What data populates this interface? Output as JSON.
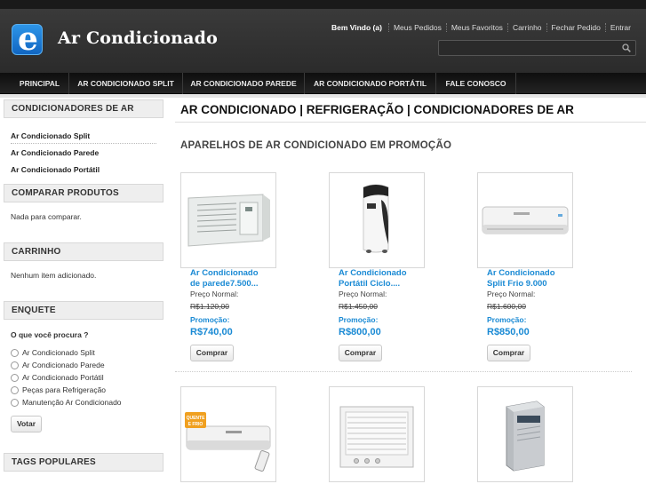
{
  "header": {
    "logo_letter": "e",
    "site_title": "Ar Condicionado",
    "welcome": "Bem Vindo (a)",
    "links": [
      "Meus Pedidos",
      "Meus Favoritos",
      "Carrinho",
      "Fechar Pedido",
      "Entrar"
    ],
    "search_placeholder": ""
  },
  "nav": {
    "items": [
      "PRINCIPAL",
      "AR CONDICIONADO SPLIT",
      "AR CONDICIONADO PAREDE",
      "AR CONDICIONADO PORTÁTIL",
      "FALE CONOSCO"
    ]
  },
  "sidebar": {
    "categories_title": "CONDICIONADORES DE AR",
    "categories": [
      "Ar Condicionado Split",
      "Ar Condicionado Parede",
      "Ar Condicionado Portátil"
    ],
    "compare_title": "COMPARAR PRODUTOS",
    "compare_text": "Nada para comparar.",
    "cart_title": "CARRINHO",
    "cart_text": "Nenhum item adicionado.",
    "poll_title": "ENQUETE",
    "poll_question": "O que você procura ?",
    "poll_options": [
      "Ar Condicionado Split",
      "Ar Condicionado Parede",
      "Ar Condicionado Portátil",
      "Peças para Refrigeração",
      "Manutenção Ar Condicionado"
    ],
    "vote_label": "Votar",
    "tags_title": "TAGS POPULARES"
  },
  "main": {
    "page_title": "AR CONDICIONADO | REFRIGERAÇÃO | CONDICIONADORES DE AR",
    "section_title": "APARELHOS DE AR CONDICIONADO EM PROMOÇÃO",
    "normal_price_label": "Preço Normal:",
    "promo_label": "Promoção:",
    "buy_label": "Comprar",
    "products": [
      {
        "name_line1": "Ar Condicionado",
        "name_line2": "de parede7.500...",
        "old_price": "R$1.120,00",
        "price": "R$740,00",
        "image": "window-ac"
      },
      {
        "name_line1": "Ar Condicionado",
        "name_line2": "Portátil Ciclo....",
        "old_price": "R$1.450,00",
        "price": "R$800,00",
        "image": "portable-ac"
      },
      {
        "name_line1": "Ar Condicionado",
        "name_line2": "Split Frio 9.000",
        "old_price": "R$1.600,00",
        "price": "R$850,00",
        "image": "split-ac"
      },
      {
        "image": "split-ac-with-remote",
        "badge": "QUENTE E FRIO"
      },
      {
        "image": "window-ac-white"
      },
      {
        "image": "portable-ac-grey"
      }
    ]
  },
  "colors": {
    "accent_blue": "#1a8ad4",
    "header_dark": "#2b2b2b",
    "nav_dark": "#141414"
  }
}
